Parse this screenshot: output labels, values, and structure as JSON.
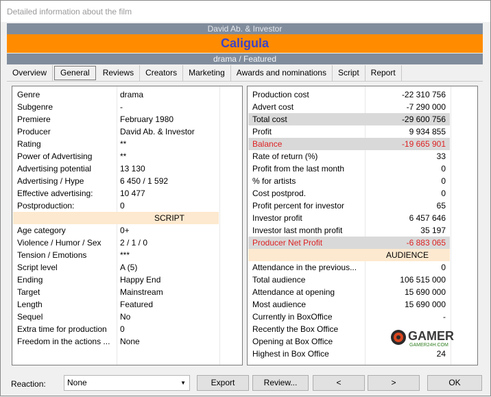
{
  "window": {
    "title": "Detailed information about the film"
  },
  "banner": {
    "studio": "David Ab. & Investor",
    "film_title": "Caligula",
    "subtitle": "drama / Featured"
  },
  "tabs": [
    {
      "label": "Overview"
    },
    {
      "label": "General"
    },
    {
      "label": "Reviews"
    },
    {
      "label": "Creators"
    },
    {
      "label": "Marketing"
    },
    {
      "label": "Awards and nominations"
    },
    {
      "label": "Script"
    },
    {
      "label": "Report"
    }
  ],
  "active_tab": "General",
  "left": [
    {
      "label": "Genre",
      "value": "drama"
    },
    {
      "label": "Subgenre",
      "value": "-"
    },
    {
      "label": "Premiere",
      "value": "February 1980"
    },
    {
      "label": "Producer",
      "value": "David Ab. & Investor"
    },
    {
      "label": "Rating",
      "value": "**"
    },
    {
      "label": "Power of Advertising",
      "value": "**"
    },
    {
      "label": "Advertising potential",
      "value": "13 130"
    },
    {
      "label": "Advertising / Hype",
      "value": "6 450 / 1 592"
    },
    {
      "label": "Effective advertising:",
      "value": "10 477"
    },
    {
      "label": "Postproduction:",
      "value": "0"
    },
    {
      "label": "",
      "value": "SCRIPT"
    },
    {
      "label": "Age category",
      "value": "0+"
    },
    {
      "label": "Violence / Humor / Sex",
      "value": "2 / 1 / 0"
    },
    {
      "label": "Tension / Emotions",
      "value": "***"
    },
    {
      "label": "Script level",
      "value": "A (5)"
    },
    {
      "label": "Ending",
      "value": "Happy End"
    },
    {
      "label": "Target",
      "value": "Mainstream"
    },
    {
      "label": "Length",
      "value": "Featured"
    },
    {
      "label": "Sequel",
      "value": "No"
    },
    {
      "label": "Extra time for production",
      "value": "0"
    },
    {
      "label": "Freedom in the actions ...",
      "value": "None"
    }
  ],
  "right": [
    {
      "label": "Production cost",
      "value": "-22 310 756"
    },
    {
      "label": "Advert cost",
      "value": "-7 290 000"
    },
    {
      "label": "Total cost",
      "value": "-29 600 756"
    },
    {
      "label": "Profit",
      "value": "9 934 855"
    },
    {
      "label": "Balance",
      "value": "-19 665 901"
    },
    {
      "label": "Rate of return (%)",
      "value": "33"
    },
    {
      "label": "Profit from the last month",
      "value": "0"
    },
    {
      "label": "% for artists",
      "value": "0"
    },
    {
      "label": "Cost postprod.",
      "value": "0"
    },
    {
      "label": "Profit percent for investor",
      "value": "65"
    },
    {
      "label": "Investor profit",
      "value": "6 457 646"
    },
    {
      "label": "Investor last month profit",
      "value": "35 197"
    },
    {
      "label": "Producer Net Profit",
      "value": "-6 883 065"
    },
    {
      "label": "",
      "value": "AUDIENCE"
    },
    {
      "label": "Attendance in the previous...",
      "value": "0"
    },
    {
      "label": "Total audience",
      "value": "106 515 000"
    },
    {
      "label": "Attendance at opening",
      "value": "15 690 000"
    },
    {
      "label": "Most audience",
      "value": "15 690 000"
    },
    {
      "label": "Currently in BoxOffice",
      "value": "-"
    },
    {
      "label": "Recently the Box Office",
      "value": ""
    },
    {
      "label": "Opening at Box Office",
      "value": ""
    },
    {
      "label": "Highest in Box Office",
      "value": "24"
    }
  ],
  "bottom": {
    "reaction_label": "Reaction:",
    "reaction_value": "None",
    "export": "Export",
    "review": "Review...",
    "prev": "<",
    "next": ">",
    "ok": "OK"
  },
  "watermark": {
    "line1": "GAMER",
    "line2": "GAMER24H.COM"
  },
  "colors": {
    "orange": "#ff8c00",
    "title_blue": "#3d44c6",
    "banner_gray": "#808c9c",
    "red": "#dd2222",
    "section": "#fde9cf"
  }
}
